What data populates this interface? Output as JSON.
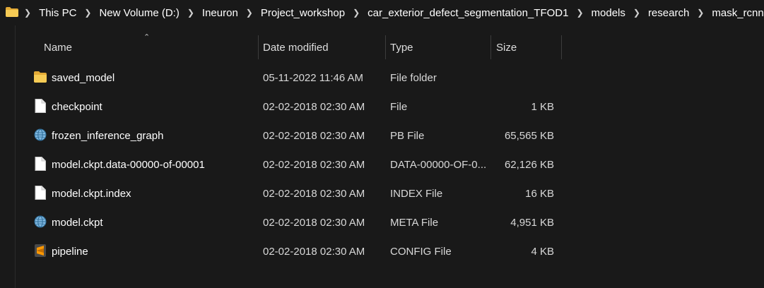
{
  "breadcrumb": [
    "This PC",
    "New Volume (D:)",
    "Ineuron",
    "Project_workshop",
    "car_exterior_defect_segmentation_TFOD1",
    "models",
    "research",
    "mask_rcnn"
  ],
  "columns": {
    "name": "Name",
    "date": "Date modified",
    "type": "Type",
    "size": "Size"
  },
  "files": [
    {
      "name": "saved_model",
      "date": "05-11-2022 11:46 AM",
      "type": "File folder",
      "size": "",
      "icon": "folder-icon"
    },
    {
      "name": "checkpoint",
      "date": "02-02-2018 02:30 AM",
      "type": "File",
      "size": "1 KB",
      "icon": "file-icon"
    },
    {
      "name": "frozen_inference_graph",
      "date": "02-02-2018 02:30 AM",
      "type": "PB File",
      "size": "65,565 KB",
      "icon": "globe-file-icon"
    },
    {
      "name": "model.ckpt.data-00000-of-00001",
      "date": "02-02-2018 02:30 AM",
      "type": "DATA-00000-OF-0...",
      "size": "62,126 KB",
      "icon": "file-icon"
    },
    {
      "name": "model.ckpt.index",
      "date": "02-02-2018 02:30 AM",
      "type": "INDEX File",
      "size": "16 KB",
      "icon": "file-icon"
    },
    {
      "name": "model.ckpt",
      "date": "02-02-2018 02:30 AM",
      "type": "META File",
      "size": "4,951 KB",
      "icon": "globe-file-icon"
    },
    {
      "name": "pipeline",
      "date": "02-02-2018 02:30 AM",
      "type": "CONFIG File",
      "size": "4 KB",
      "icon": "sublime-file-icon"
    }
  ],
  "colors": {
    "background": "#191919",
    "folder": "#f0c24b",
    "globe": "#6aa6d6",
    "sublime": "#ff9800"
  }
}
